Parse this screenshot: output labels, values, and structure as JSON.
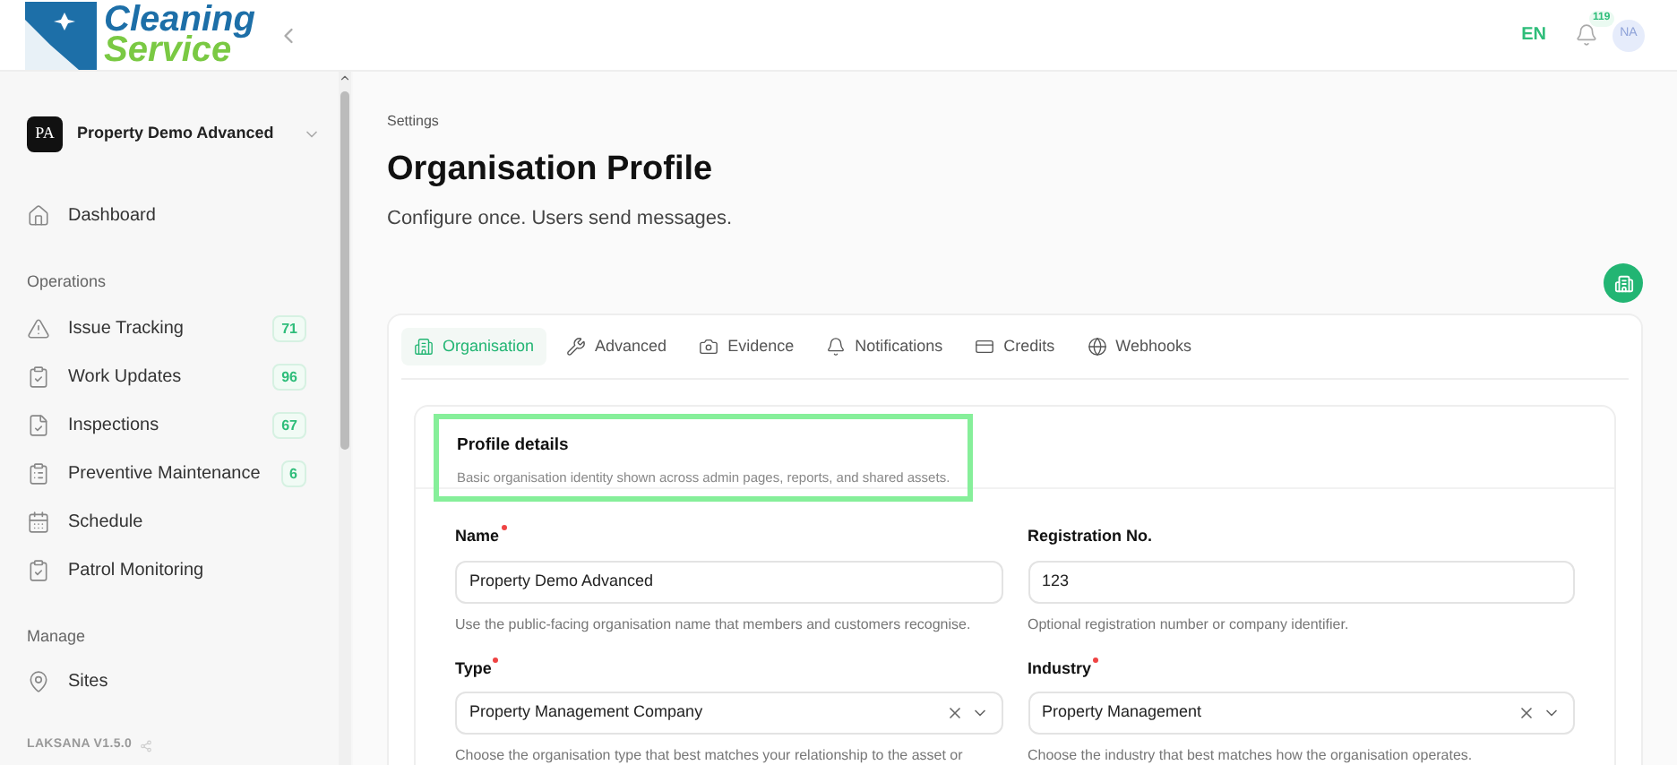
{
  "logo": {
    "line_1": "Cleaning",
    "line_2": "Service"
  },
  "header": {
    "language": "EN",
    "notification_count": "119",
    "avatar": "NA"
  },
  "sidebar": {
    "workspace": {
      "initials": "PA",
      "name": "Property Demo Advanced"
    },
    "top_items": [
      {
        "label": "Dashboard",
        "kind": "home",
        "selected": false
      }
    ],
    "sections": [
      {
        "title": "Operations",
        "items": [
          {
            "label": "Issue Tracking",
            "kind": "alert",
            "badge": "71"
          },
          {
            "label": "Work Updates",
            "kind": "clipboard",
            "badge": "96"
          },
          {
            "label": "Inspections",
            "kind": "file",
            "badge": "67"
          },
          {
            "label": "Preventive Maintenance",
            "kind": "list",
            "badge": "6"
          },
          {
            "label": "Schedule",
            "kind": "calendar"
          },
          {
            "label": "Patrol Monitoring",
            "kind": "clipboard"
          }
        ]
      },
      {
        "title": "Manage",
        "items": [
          {
            "label": "Sites",
            "kind": "pin"
          }
        ]
      }
    ],
    "version": "LAKSANA V1.5.0"
  },
  "page": {
    "breadcrumb": "Settings",
    "title": "Organisation Profile",
    "subtitle": "Configure once. Users send messages."
  },
  "tabs": [
    {
      "label": "Organisation",
      "kind": "building",
      "selected": true
    },
    {
      "label": "Advanced",
      "kind": "tools",
      "selected": false
    },
    {
      "label": "Evidence",
      "kind": "camera",
      "selected": false
    },
    {
      "label": "Notifications",
      "kind": "bell",
      "selected": false
    },
    {
      "label": "Credits",
      "kind": "card",
      "selected": false
    },
    {
      "label": "Webhooks",
      "kind": "globe",
      "selected": false
    }
  ],
  "section": {
    "title": "Profile details",
    "description": "Basic organisation identity shown across admin pages, reports, and shared assets.",
    "highlighted": true
  },
  "fields": [
    {
      "kind": "text",
      "label": "Name",
      "required": true,
      "value": "Property Demo Advanced",
      "help": "Use the public-facing organisation name that members and customers recognise."
    },
    {
      "kind": "text",
      "label": "Registration No.",
      "required": false,
      "value": "123",
      "help": "Optional registration number or company identifier."
    },
    {
      "kind": "select",
      "label": "Type",
      "required": true,
      "value": "Property Management Company",
      "help": "Choose the organisation type that best matches your relationship to the asset or"
    },
    {
      "kind": "select",
      "label": "Industry",
      "required": true,
      "value": "Property Management",
      "help": "Choose the industry that best matches how the organisation operates."
    }
  ]
}
